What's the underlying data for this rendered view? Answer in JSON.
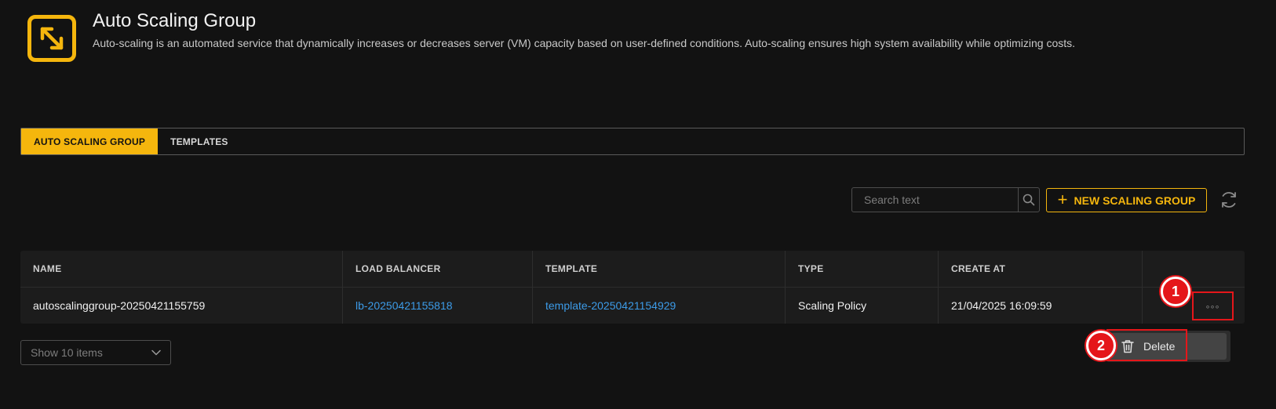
{
  "header": {
    "title": "Auto Scaling Group",
    "description": "Auto-scaling is an automated service that dynamically increases or decreases server (VM) capacity based on user-defined conditions. Auto-scaling ensures high system availability while optimizing costs.",
    "icon": "resize-arrows-icon",
    "accent_color": "#f5b60d"
  },
  "tabs": [
    {
      "label": "AUTO SCALING GROUP",
      "active": true
    },
    {
      "label": "TEMPLATES",
      "active": false
    }
  ],
  "toolbar": {
    "search_placeholder": "Search text",
    "new_button_label": "NEW SCALING GROUP",
    "new_button_icon": "plus-icon",
    "refresh_icon": "refresh-icon"
  },
  "table": {
    "columns": [
      "NAME",
      "LOAD BALANCER",
      "TEMPLATE",
      "TYPE",
      "CREATE AT"
    ],
    "rows": [
      {
        "name": "autoscalinggroup-20250421155759",
        "load_balancer": "lb-20250421155818",
        "template": "template-20250421154929",
        "type": "Scaling Policy",
        "created_at": "21/04/2025 16:09:59"
      }
    ],
    "more_label": "◦◦◦",
    "link_color": "#3c9be8"
  },
  "row_menu": {
    "items": [
      {
        "label": "Delete",
        "icon": "trash-icon"
      }
    ]
  },
  "markers": [
    "1",
    "2"
  ],
  "pagination": {
    "page_size_label": "Show 10 items"
  }
}
